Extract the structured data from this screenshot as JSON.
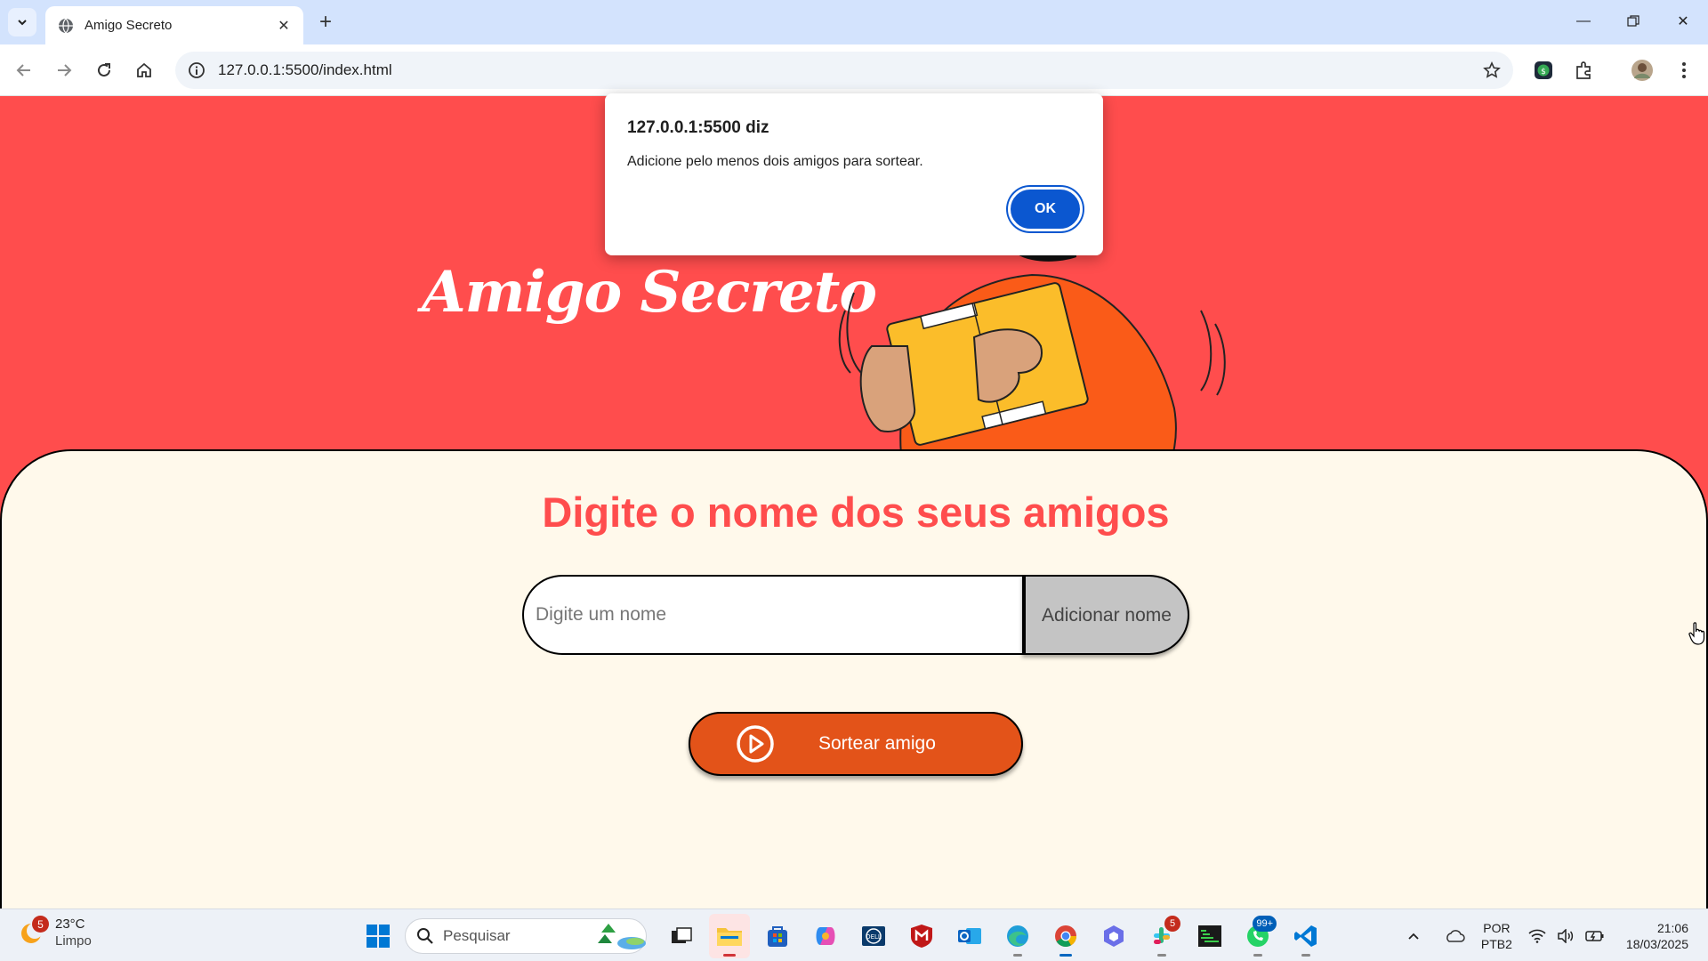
{
  "browser": {
    "tab_title": "Amigo Secreto",
    "url": "127.0.0.1:5500/index.html"
  },
  "page": {
    "hero_title": "Amigo Secreto",
    "section_title": "Digite o nome dos seus amigos",
    "input_placeholder": "Digite um nome",
    "add_button_label": "Adicionar nome",
    "draw_button_label": "Sortear amigo",
    "colors": {
      "hero_bg": "#ff4d4d",
      "card_bg": "#fff9eb",
      "draw_button": "#e35319",
      "add_button": "#c4c4c4"
    }
  },
  "alert": {
    "title": "127.0.0.1:5500 diz",
    "message": "Adicione pelo menos dois amigos para sortear.",
    "ok_label": "OK"
  },
  "taskbar": {
    "weather_badge": "5",
    "temperature": "23°C",
    "condition": "Limpo",
    "search_placeholder": "Pesquisar",
    "slack_badge": "5",
    "whatsapp_badge": "99+",
    "lang_line1": "POR",
    "lang_line2": "PTB2",
    "time": "21:06",
    "date": "18/03/2025"
  }
}
